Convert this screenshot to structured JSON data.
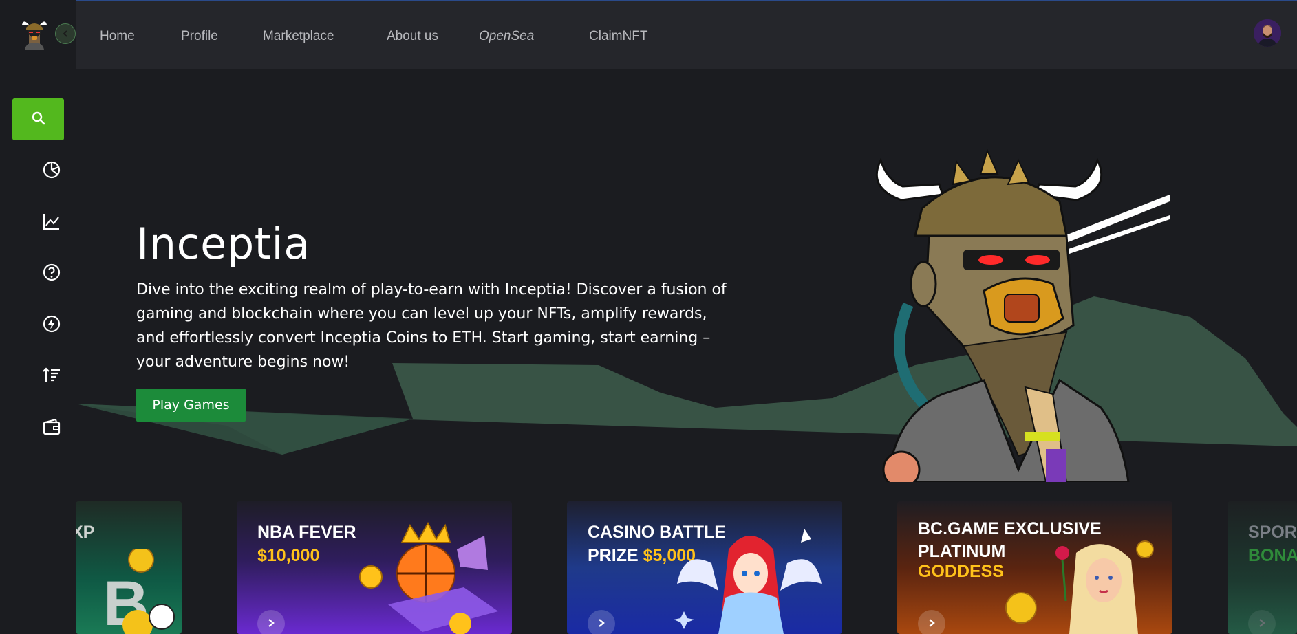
{
  "nav": {
    "items": [
      "Home",
      "Profile",
      "Marketplace",
      "About us",
      "OpenSea",
      "ClaimNFT"
    ]
  },
  "sidebar": {
    "icons": [
      "search-icon",
      "pie-chart-icon",
      "line-chart-icon",
      "help-icon",
      "lightning-icon",
      "sort-icon",
      "wallet-icon"
    ]
  },
  "hero": {
    "title": "Inceptia",
    "description": "Dive into the exciting realm of play-to-earn with Inceptia! Discover a fusion of gaming and blockchain where you can level up your NFTs, amplify rewards, and effortlessly convert Inceptia Coins to ETH. Start gaming, start earning – your adventure begins now!",
    "button": "Play Games"
  },
  "cards": [
    {
      "line1": "XP",
      "line2": ""
    },
    {
      "line1": "NBA FEVER",
      "line2_prefix": "",
      "line2_gold": "$10,000"
    },
    {
      "line1": "CASINO BATTLE",
      "line2_prefix": "PRIZE ",
      "line2_gold": "$5,000"
    },
    {
      "line1": "BC.GAME EXCLUSIVE",
      "line2": "PLATINUM",
      "line3_gold": "GODDESS"
    },
    {
      "line1": "SPORT",
      "line2_gold": "BONA"
    }
  ],
  "colors": {
    "accent": "#53b81e",
    "button": "#1c8b3a",
    "background": "#1b1c20",
    "nav_bg": "#25262b"
  }
}
